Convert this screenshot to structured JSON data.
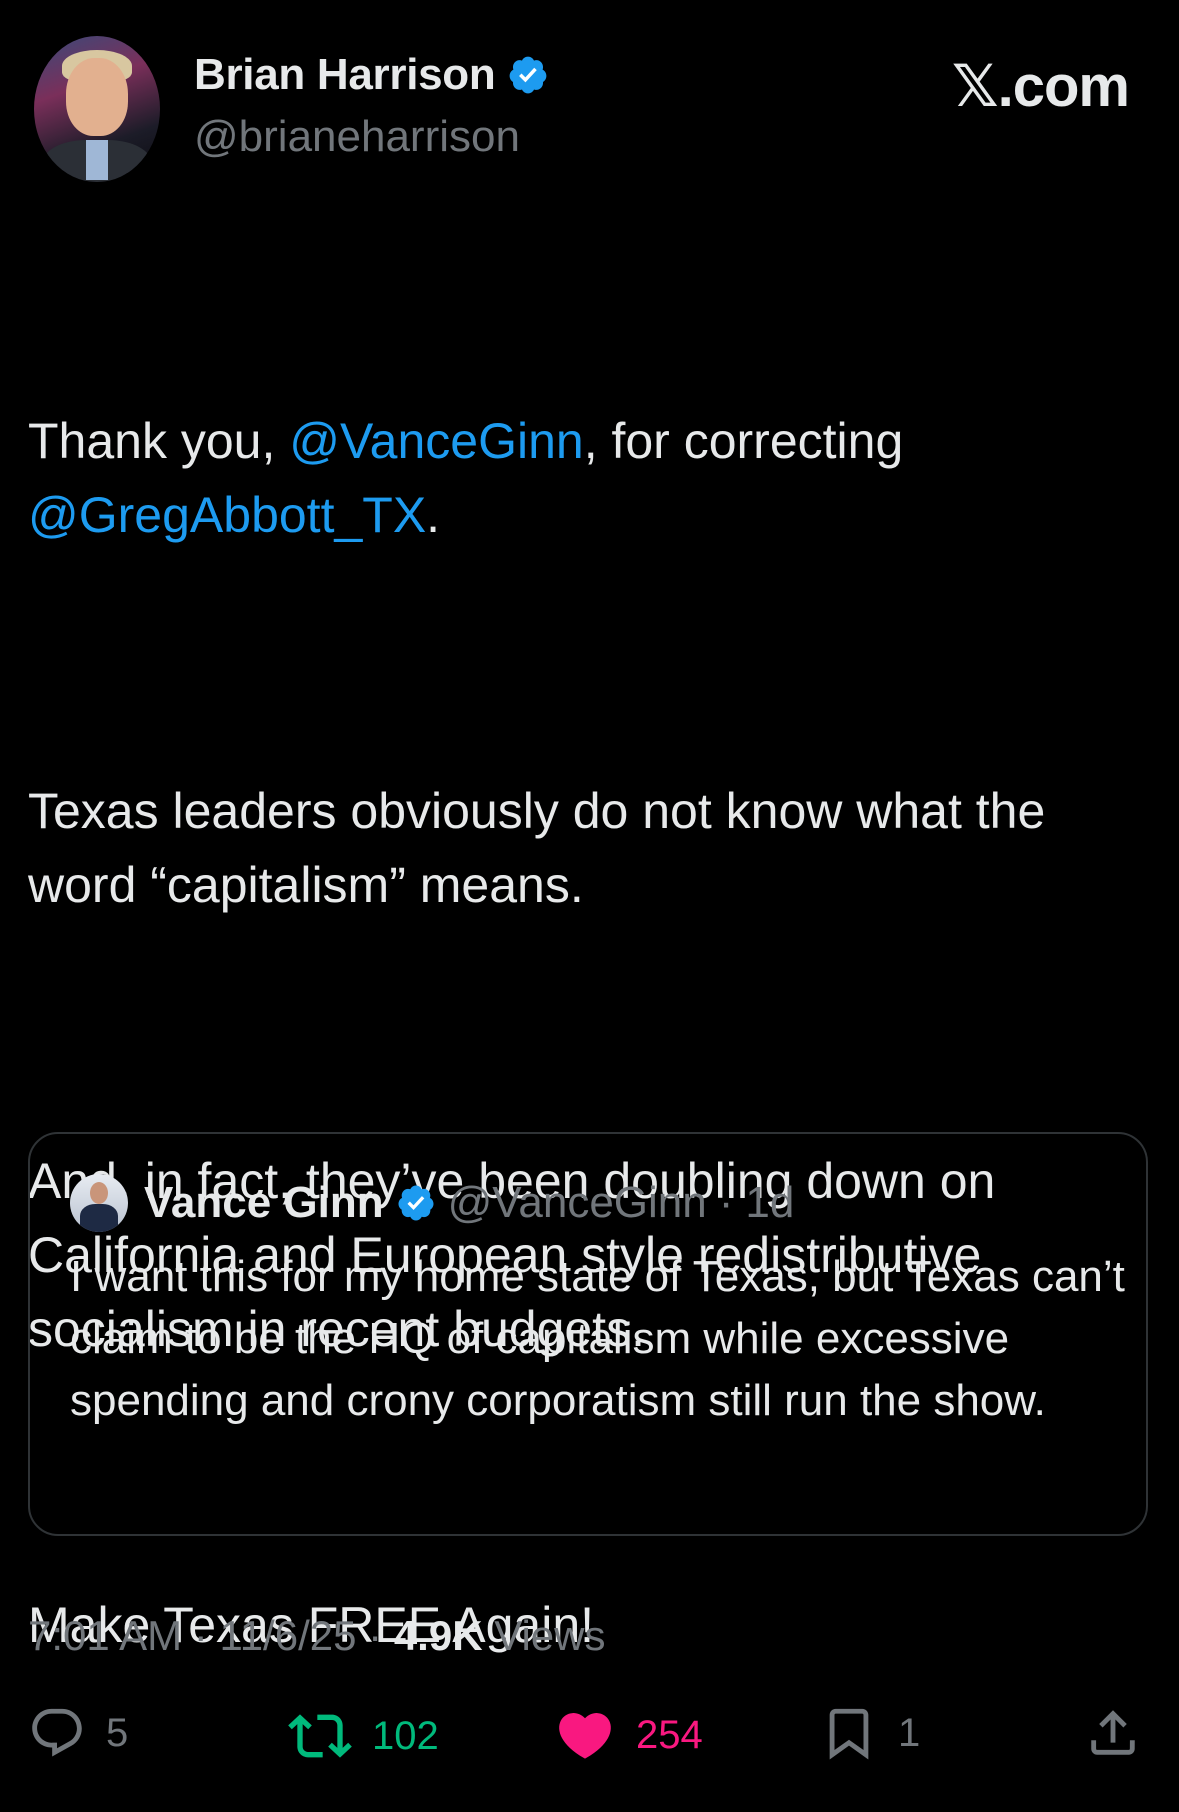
{
  "author": {
    "name": "Brian Harrison",
    "handle": "@brianeharrison",
    "verified": true
  },
  "brand": "𝕏.com",
  "tweet": {
    "paragraph1": {
      "prefix": "Thank you, ",
      "mention1": "@VanceGinn",
      "middle": ", for correcting ",
      "mention2": "@GregAbbott_TX",
      "suffix": "."
    },
    "paragraph2": "Texas leaders obviously do not know what the word “capitalism” means.",
    "paragraph3": "And, in fact, they’ve been doubling down on California and European style redistributive socialism in recent budgets.",
    "paragraph4": "Make Texas FREE Again!"
  },
  "quoted_tweet": {
    "name": "Vance Ginn",
    "handle": "@VanceGinn",
    "separator": "·",
    "age": "1d",
    "text": "I want this for my home state of Texas, but Texas can’t claim to be the HQ of capitalism while excessive spending and crony corporatism still run the show."
  },
  "meta": {
    "time": "7:01 AM",
    "date": "11/6/25",
    "views_count": "4.9K",
    "views_label": "Views",
    "separator": "·"
  },
  "actions": {
    "replies": "5",
    "reposts": "102",
    "likes": "254",
    "bookmarks": "1"
  },
  "colors": {
    "background": "#000000",
    "text": "#e7e9ea",
    "secondary": "#71767b",
    "link": "#1d9bf0",
    "repost": "#00ba7c",
    "like": "#f91880",
    "border": "#2f3336"
  },
  "icons": [
    "verified-badge-icon",
    "reply-icon",
    "repost-icon",
    "like-icon",
    "bookmark-icon",
    "share-icon"
  ]
}
